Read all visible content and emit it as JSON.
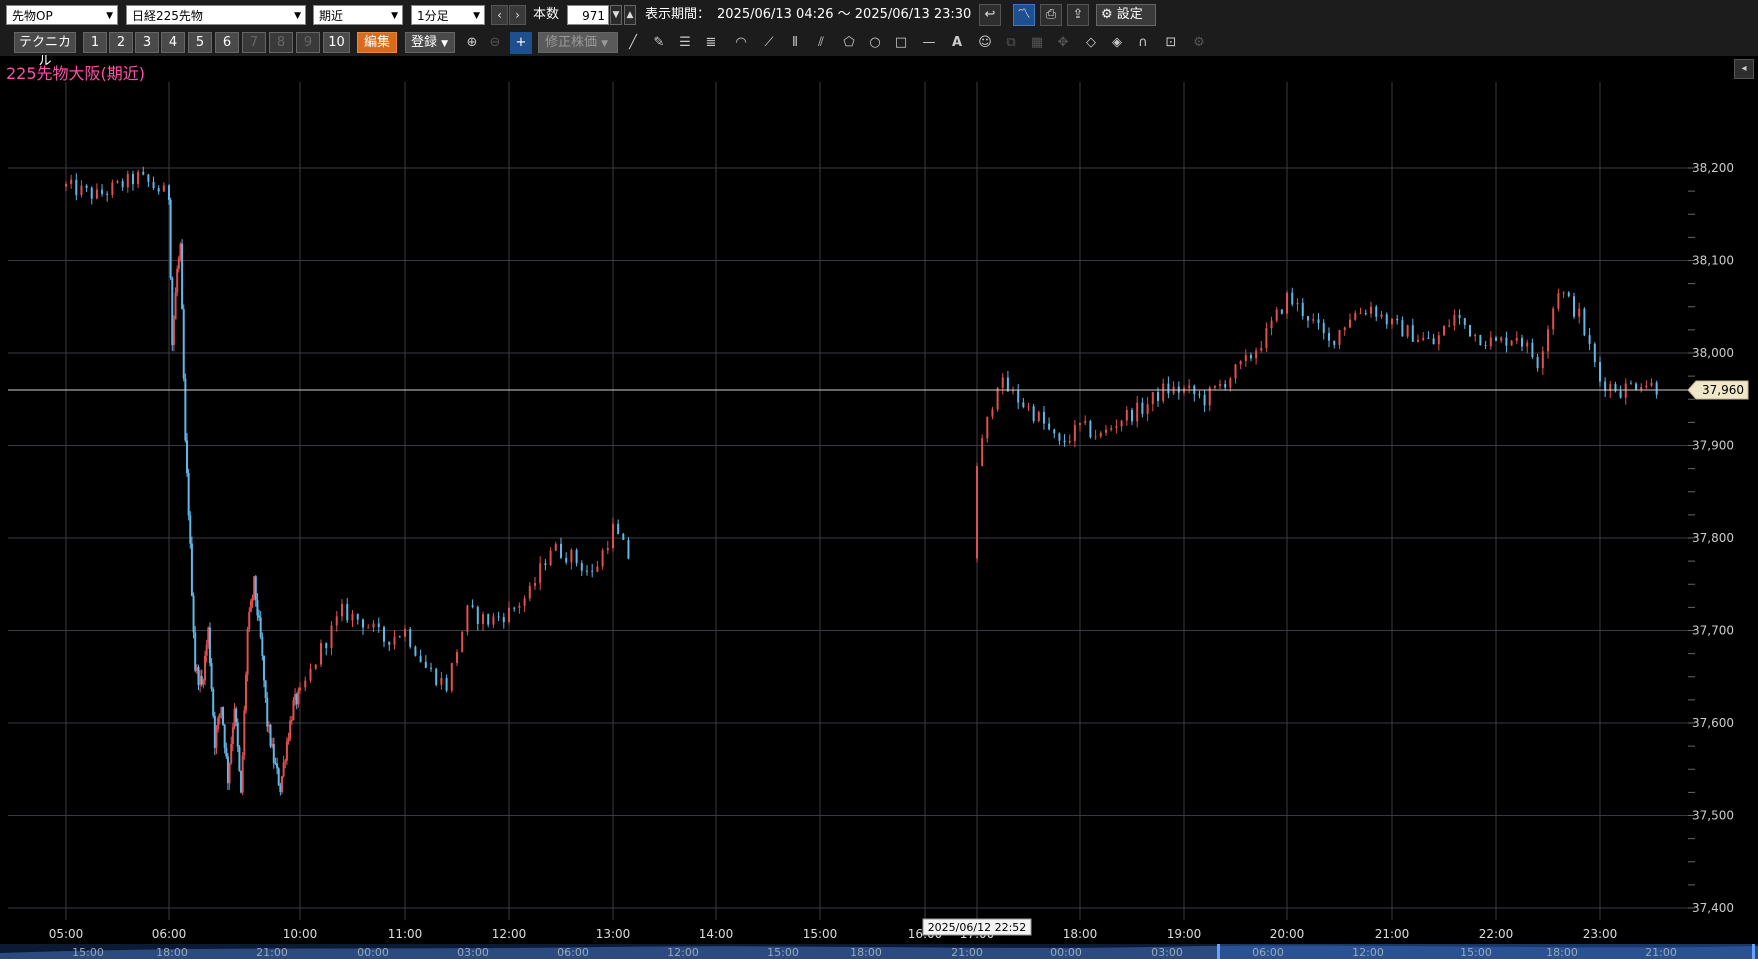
{
  "toolbar": {
    "product_select": "先物OP",
    "instrument_select": "日経225先物",
    "contract_select": "期近",
    "interval_select": "1分足",
    "prev_label": "‹",
    "next_label": "›",
    "count_label": "本数",
    "count_value": "971",
    "period_label": "表示期間：",
    "period_value": "2025/06/13 04:26 ～ 2025/06/13 23:30",
    "settings_label": "設定"
  },
  "toolbar2": {
    "technical_label": "テクニカル",
    "presets": [
      "1",
      "2",
      "3",
      "4",
      "5",
      "6",
      "7",
      "8",
      "9",
      "10"
    ],
    "edit_label": "編集",
    "register_label": "登録",
    "adjusted_price_label": "修正株価"
  },
  "chart": {
    "title": "225先物大阪(期近)",
    "current_price_label": "37,960",
    "cursor_time_label": "2025/06/12 22:52",
    "colors": {
      "up": "#e05050",
      "down": "#5fb8e8",
      "grid": "#3a3a44",
      "price_line": "#cfcfcf"
    }
  },
  "chart_data": {
    "type": "candlestick",
    "ylim": [
      37400,
      38250
    ],
    "y_ticks": [
      "38,200",
      "38,100",
      "38,000",
      "37,900",
      "37,800",
      "37,700",
      "37,600",
      "37,500",
      "37,400"
    ],
    "x_ticks": [
      "05:00",
      "06:00",
      "10:00",
      "11:00",
      "12:00",
      "13:00",
      "14:00",
      "15:00",
      "16:00",
      "17:00",
      "18:00",
      "19:00",
      "20:00",
      "21:00",
      "22:00",
      "23:00"
    ],
    "navigator_ticks": [
      "15:00",
      "18:00",
      "21:00",
      "00:00",
      "03:00",
      "06:00",
      "12:00",
      "15:00",
      "18:00",
      "21:00",
      "00:00",
      "03:00",
      "06:00",
      "12:00",
      "15:00",
      "18:00",
      "21:00"
    ],
    "current_price": 37960,
    "price_path": [
      [
        5.0,
        38180
      ],
      [
        5.3,
        38170
      ],
      [
        5.7,
        38190
      ],
      [
        6.0,
        38170
      ],
      [
        6.1,
        38010
      ],
      [
        6.25,
        38090
      ],
      [
        6.35,
        38110
      ],
      [
        6.5,
        37900
      ],
      [
        6.6,
        37830
      ],
      [
        6.8,
        37660
      ],
      [
        7.0,
        37640
      ],
      [
        7.2,
        37700
      ],
      [
        7.4,
        37580
      ],
      [
        7.6,
        37620
      ],
      [
        7.8,
        37540
      ],
      [
        8.0,
        37620
      ],
      [
        8.2,
        37520
      ],
      [
        8.4,
        37700
      ],
      [
        8.6,
        37750
      ],
      [
        8.8,
        37690
      ],
      [
        9.0,
        37600
      ],
      [
        9.2,
        37560
      ],
      [
        9.4,
        37530
      ],
      [
        9.6,
        37580
      ],
      [
        9.8,
        37620
      ],
      [
        10.0,
        37630
      ],
      [
        10.2,
        37680
      ],
      [
        10.4,
        37720
      ],
      [
        10.6,
        37710
      ],
      [
        10.8,
        37690
      ],
      [
        11.0,
        37700
      ],
      [
        11.2,
        37660
      ],
      [
        11.4,
        37640
      ],
      [
        11.6,
        37720
      ],
      [
        11.8,
        37710
      ],
      [
        12.0,
        37720
      ],
      [
        12.2,
        37740
      ],
      [
        12.4,
        37790
      ],
      [
        12.6,
        37780
      ],
      [
        12.8,
        37760
      ],
      [
        13.0,
        37810
      ],
      [
        13.2,
        37770
      ],
      [
        17.0,
        37880
      ],
      [
        17.2,
        37970
      ],
      [
        17.4,
        37950
      ],
      [
        17.6,
        37930
      ],
      [
        17.8,
        37900
      ],
      [
        18.0,
        37920
      ],
      [
        18.2,
        37910
      ],
      [
        18.4,
        37930
      ],
      [
        18.6,
        37940
      ],
      [
        18.8,
        37960
      ],
      [
        19.0,
        37960
      ],
      [
        19.2,
        37950
      ],
      [
        19.4,
        37970
      ],
      [
        19.6,
        37990
      ],
      [
        19.8,
        38020
      ],
      [
        20.0,
        38060
      ],
      [
        20.2,
        38040
      ],
      [
        20.4,
        38010
      ],
      [
        20.6,
        38040
      ],
      [
        20.8,
        38050
      ],
      [
        21.0,
        38030
      ],
      [
        21.2,
        38020
      ],
      [
        21.4,
        38010
      ],
      [
        21.6,
        38040
      ],
      [
        21.8,
        38020
      ],
      [
        22.0,
        38010
      ],
      [
        22.2,
        38020
      ],
      [
        22.4,
        37990
      ],
      [
        22.6,
        38070
      ],
      [
        22.8,
        38040
      ],
      [
        23.0,
        37970
      ],
      [
        23.2,
        37960
      ],
      [
        23.4,
        37970
      ],
      [
        23.6,
        37960
      ]
    ]
  }
}
